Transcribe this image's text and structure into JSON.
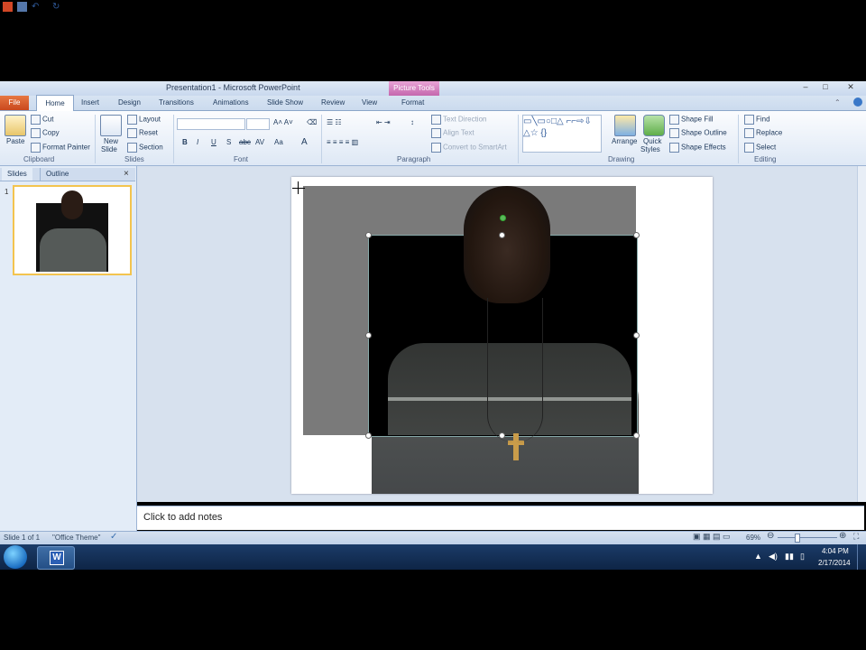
{
  "window": {
    "title": "Presentation1 - Microsoft PowerPoint",
    "context_tab": "Picture Tools",
    "controls": [
      "–",
      "□",
      "✕"
    ]
  },
  "tabs": {
    "file": "File",
    "home": "Home",
    "others": [
      "Insert",
      "Design",
      "Transitions",
      "Animations",
      "Slide Show",
      "Review",
      "View",
      "Format"
    ]
  },
  "ribbon": {
    "clipboard": {
      "paste": "Paste",
      "cut": "Cut",
      "copy": "Copy",
      "format_painter": "Format Painter",
      "label": "Clipboard"
    },
    "slides": {
      "new_slide": "New",
      "new_slide2": "Slide",
      "layout": "Layout",
      "reset": "Reset",
      "section": "Section",
      "label": "Slides"
    },
    "font": {
      "label": "Font",
      "bold": "B",
      "italic": "I",
      "underline": "U",
      "shadow": "S",
      "strike": "abc",
      "spacing": "AV",
      "case": "Aa",
      "color": "A"
    },
    "paragraph": {
      "text_direction": "Text Direction",
      "align_text": "Align Text",
      "smartart": "Convert to SmartArt",
      "label": "Paragraph"
    },
    "drawing": {
      "arrange": "Arrange",
      "quick_styles1": "Quick",
      "quick_styles2": "Styles",
      "shape_fill": "Shape Fill",
      "shape_outline": "Shape Outline",
      "shape_effects": "Shape Effects",
      "label": "Drawing"
    },
    "editing": {
      "find": "Find",
      "replace": "Replace",
      "select": "Select",
      "label": "Editing"
    }
  },
  "left_panel": {
    "tabs": [
      "Slides",
      "Outline"
    ],
    "close": "×",
    "slide_number": "1"
  },
  "notes": {
    "placeholder": "Click to add notes"
  },
  "status_bar": {
    "slide_info": "Slide 1 of 1",
    "theme": "\"Office Theme\"",
    "zoom": "69%"
  },
  "taskbar": {
    "time": "4:04 PM",
    "date": "2/17/2014",
    "word_icon": "W"
  }
}
